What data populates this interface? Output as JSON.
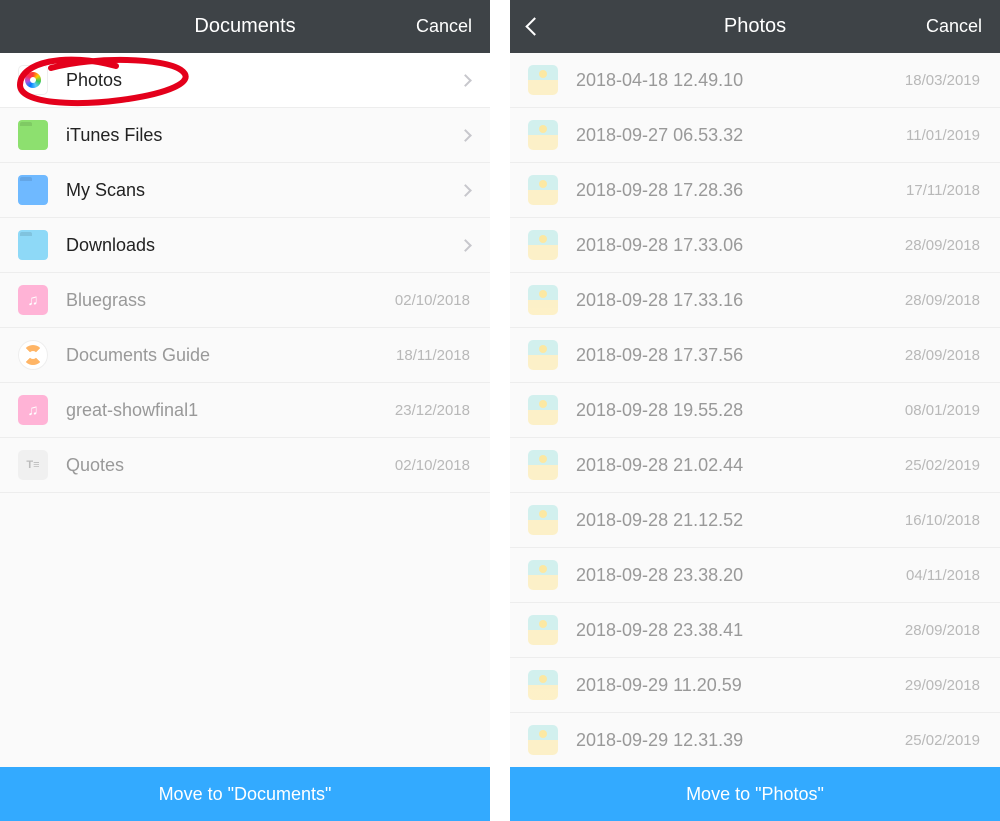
{
  "screens": {
    "left": {
      "header": {
        "title": "Documents",
        "cancel": "Cancel"
      },
      "bottom_bar": "Move to \"Documents\"",
      "items": [
        {
          "icon": "photos",
          "label": "Photos",
          "has_chevron": true
        },
        {
          "icon": "folder-green",
          "label": "iTunes Files",
          "has_chevron": true
        },
        {
          "icon": "folder-blue",
          "label": "My Scans",
          "has_chevron": true
        },
        {
          "icon": "folder-cyan",
          "label": "Downloads",
          "has_chevron": true
        },
        {
          "icon": "music",
          "label": "Bluegrass",
          "date": "02/10/2018",
          "dimmed": true
        },
        {
          "icon": "lifebuoy",
          "label": "Documents Guide",
          "date": "18/11/2018",
          "dimmed": true
        },
        {
          "icon": "music",
          "label": "great-showfinal1",
          "date": "23/12/2018",
          "dimmed": true
        },
        {
          "icon": "text",
          "label": "Quotes",
          "date": "02/10/2018",
          "dimmed": true
        }
      ]
    },
    "right": {
      "header": {
        "title": "Photos",
        "cancel": "Cancel"
      },
      "bottom_bar": "Move to \"Photos\"",
      "items": [
        {
          "icon": "thumb",
          "label": "2018-04-18 12.49.10",
          "date": "18/03/2019",
          "dimmed": true
        },
        {
          "icon": "thumb",
          "label": "2018-09-27 06.53.32",
          "date": "11/01/2019",
          "dimmed": true
        },
        {
          "icon": "thumb",
          "label": "2018-09-28 17.28.36",
          "date": "17/11/2018",
          "dimmed": true
        },
        {
          "icon": "thumb",
          "label": "2018-09-28 17.33.06",
          "date": "28/09/2018",
          "dimmed": true
        },
        {
          "icon": "thumb",
          "label": "2018-09-28 17.33.16",
          "date": "28/09/2018",
          "dimmed": true
        },
        {
          "icon": "thumb",
          "label": "2018-09-28 17.37.56",
          "date": "28/09/2018",
          "dimmed": true
        },
        {
          "icon": "thumb",
          "label": "2018-09-28 19.55.28",
          "date": "08/01/2019",
          "dimmed": true
        },
        {
          "icon": "thumb",
          "label": "2018-09-28 21.02.44",
          "date": "25/02/2019",
          "dimmed": true
        },
        {
          "icon": "thumb",
          "label": "2018-09-28 21.12.52",
          "date": "16/10/2018",
          "dimmed": true
        },
        {
          "icon": "thumb",
          "label": "2018-09-28 23.38.20",
          "date": "04/11/2018",
          "dimmed": true
        },
        {
          "icon": "thumb",
          "label": "2018-09-28 23.38.41",
          "date": "28/09/2018",
          "dimmed": true
        },
        {
          "icon": "thumb",
          "label": "2018-09-29 11.20.59",
          "date": "29/09/2018",
          "dimmed": true
        },
        {
          "icon": "thumb",
          "label": "2018-09-29 12.31.39",
          "date": "25/02/2019",
          "dimmed": true
        }
      ]
    }
  },
  "annotation_color": "#e4001b"
}
